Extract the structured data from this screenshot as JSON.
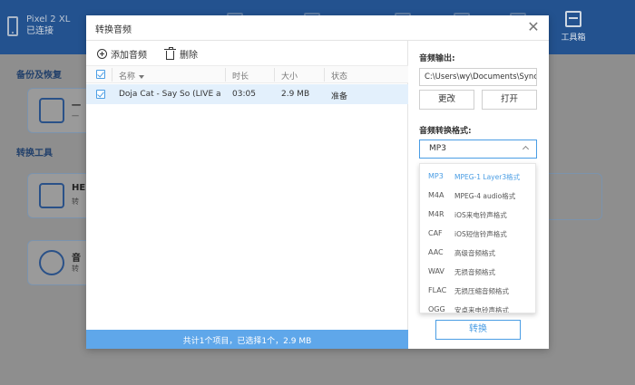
{
  "header": {
    "device_name": "Pixel 2 XL",
    "device_status": "已连接",
    "toolbox_label": "工具箱"
  },
  "background": {
    "section_backup": "备份及恢复",
    "section_convert": "转换工具",
    "card1_text": "一",
    "card1_sub": "一",
    "card2_text": "HE",
    "card2_sub": "转",
    "card3_text": "音",
    "card3_sub": "转"
  },
  "dialog": {
    "title": "转换音频",
    "close_symbol": "✕",
    "toolbar": {
      "add_label": "添加音频",
      "delete_label": "删除"
    },
    "table": {
      "columns": [
        "名称",
        "时长",
        "大小",
        "状态"
      ],
      "rows": [
        {
          "name": "Doja Cat - Say So (LIVE at th...",
          "duration": "03:05",
          "size": "2.9 MB",
          "status": "准备"
        }
      ]
    },
    "status_text": "共计1个项目，已选择1个，2.9 MB",
    "output": {
      "label": "音频输出:",
      "path": "C:\\Users\\wy\\Documents\\Syncios",
      "change_label": "更改",
      "open_label": "打开"
    },
    "format": {
      "label": "音频转换格式:",
      "selected": "MP3",
      "options": [
        {
          "code": "MP3",
          "desc": "MPEG-1 Layer3格式"
        },
        {
          "code": "M4A",
          "desc": "MPEG-4 audio格式"
        },
        {
          "code": "M4R",
          "desc": "iOS来电铃声格式"
        },
        {
          "code": "CAF",
          "desc": "iOS短信铃声格式"
        },
        {
          "code": "AAC",
          "desc": "高级音频格式"
        },
        {
          "code": "WAV",
          "desc": "无损音频格式"
        },
        {
          "code": "FLAC",
          "desc": "无损压缩音频格式"
        },
        {
          "code": "OGG",
          "desc": "安卓来电铃声格式"
        }
      ]
    },
    "convert_label": "转换"
  },
  "colors": {
    "accent": "#4a9de4",
    "header_bg": "#23528f",
    "status_bar": "#5fa7ea",
    "row_selected": "#e3f0fc"
  }
}
